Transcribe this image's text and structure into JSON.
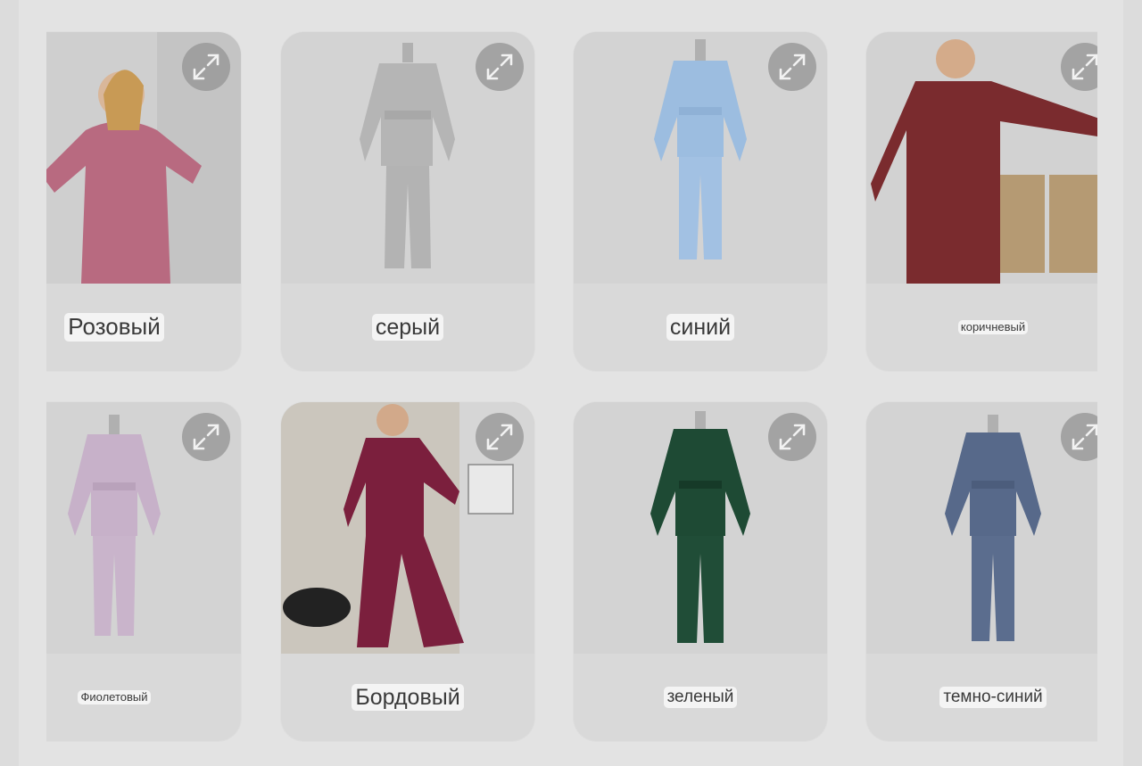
{
  "colors": {
    "page_bg": "#dcdcdc",
    "card_bg": "#d9d9d9",
    "label_bg": "#f4f4f4",
    "expand_bg": "#969696"
  },
  "icons": {
    "expand": "expand-arrows-icon"
  },
  "cards": [
    {
      "label": "Розовый",
      "garment_color": "#b86a80",
      "photo": "model"
    },
    {
      "label": "серый",
      "garment_color": "#b5b5b5",
      "photo": "mannequin"
    },
    {
      "label": "синий",
      "garment_color": "#9cbde0",
      "photo": "mannequin"
    },
    {
      "label": "коричневый",
      "garment_color": "#7a2b2e",
      "photo": "model"
    },
    {
      "label": "Фиолетовый",
      "garment_color": "#c7b1c9",
      "photo": "mannequin"
    },
    {
      "label": "Бордовый",
      "garment_color": "#7b1f3d",
      "photo": "model"
    },
    {
      "label": "зеленый",
      "garment_color": "#1e4a34",
      "photo": "mannequin"
    },
    {
      "label": "темно-синий",
      "garment_color": "#57698a",
      "photo": "mannequin"
    }
  ]
}
